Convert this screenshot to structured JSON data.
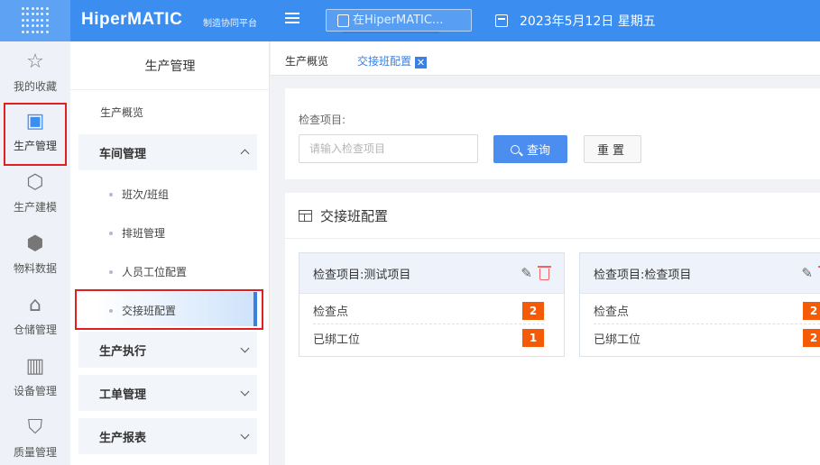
{
  "header": {
    "brand": "HiperMATIC",
    "brand_sub": "制造协同平台",
    "search_placeholder": "在HiperMATIC...",
    "date": "2023年5月12日 星期五"
  },
  "rail": {
    "items": [
      {
        "label": "我的收藏",
        "icon": "star-icon"
      },
      {
        "label": "生产管理",
        "icon": "production-icon"
      },
      {
        "label": "生产建模",
        "icon": "cube-icon"
      },
      {
        "label": "物料数据",
        "icon": "box-icon"
      },
      {
        "label": "仓储管理",
        "icon": "warehouse-icon"
      },
      {
        "label": "设备管理",
        "icon": "device-icon"
      },
      {
        "label": "质量管理",
        "icon": "shield-icon"
      }
    ]
  },
  "sidebar": {
    "title": "生产管理",
    "overview": "生产概览",
    "groups": [
      {
        "label": "车间管理"
      },
      {
        "label": "生产执行"
      },
      {
        "label": "工单管理"
      },
      {
        "label": "生产报表"
      }
    ],
    "sub_items": [
      {
        "label": "班次/班组"
      },
      {
        "label": "排班管理"
      },
      {
        "label": "人员工位配置"
      },
      {
        "label": "交接班配置"
      }
    ]
  },
  "tabs": [
    {
      "label": "生产概览"
    },
    {
      "label": "交接班配置"
    }
  ],
  "filter": {
    "label": "检查项目:",
    "placeholder": "请输入检查项目",
    "query_label": "查询",
    "reset_label": "重置"
  },
  "panel": {
    "title": "交接班配置",
    "cards": [
      {
        "title": "检查项目:测试项目",
        "rows": [
          {
            "label": "检查点",
            "count": "2"
          },
          {
            "label": "已绑工位",
            "count": "1"
          }
        ]
      },
      {
        "title": "检查项目:检查项目",
        "rows": [
          {
            "label": "检查点",
            "count": "2"
          },
          {
            "label": "已绑工位",
            "count": "2"
          }
        ]
      }
    ]
  },
  "colors": {
    "primary": "#3b8ef0",
    "badge": "#f55a06",
    "highlight": "#e02020"
  }
}
